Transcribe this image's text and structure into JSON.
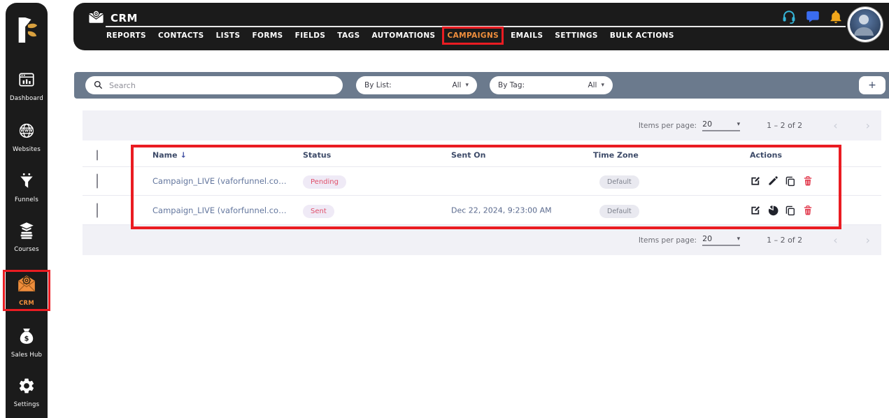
{
  "app": {
    "window_title": "CRM"
  },
  "colors": {
    "sidebar_bg": "#1b1b1b",
    "accent_orange": "#ef8e3c",
    "annotation_red": "#ea1c22",
    "filter_bar_bg": "#6b7a8d",
    "strip_bg": "#f1f1f6",
    "header_text": "#3c4a68",
    "row_link_text": "#64779e",
    "badge_red_text": "#e0506a",
    "badge_red_bg": "#efeaf6",
    "badge_gray_text": "#7d818c",
    "badge_gray_bg": "#e9e9f0",
    "delete_red": "#e23b4e",
    "headset_cyan": "#35b6d9",
    "chat_blue": "#3a6df0",
    "bell_amber": "#f2a71b"
  },
  "sidebar": {
    "items": [
      {
        "label": "Dashboard",
        "icon": "dashboard-icon",
        "active": false
      },
      {
        "label": "Websites",
        "icon": "globe-icon",
        "active": false
      },
      {
        "label": "Funnels",
        "icon": "funnel-icon",
        "active": false
      },
      {
        "label": "Courses",
        "icon": "courses-icon",
        "active": false
      },
      {
        "label": "CRM",
        "icon": "crm-envelope-icon",
        "active": true,
        "annotated": true
      },
      {
        "label": "Sales Hub",
        "icon": "money-bag-icon",
        "active": false
      },
      {
        "label": "Settings",
        "icon": "gear-icon",
        "active": false
      }
    ]
  },
  "header": {
    "title": "CRM",
    "nav": [
      {
        "label": "REPORTS",
        "active": false
      },
      {
        "label": "CONTACTS",
        "active": false
      },
      {
        "label": "LISTS",
        "active": false
      },
      {
        "label": "FORMS",
        "active": false
      },
      {
        "label": "FIELDS",
        "active": false
      },
      {
        "label": "TAGS",
        "active": false
      },
      {
        "label": "AUTOMATIONS",
        "active": false
      },
      {
        "label": "CAMPAIGNS",
        "active": true,
        "annotated": true
      },
      {
        "label": "EMAILS",
        "active": false
      },
      {
        "label": "SETTINGS",
        "active": false
      },
      {
        "label": "BULK ACTIONS",
        "active": false
      }
    ],
    "icons": [
      "headset-icon",
      "chat-icon",
      "bell-icon",
      "avatar"
    ]
  },
  "filter_bar": {
    "search_placeholder": "Search",
    "by_list_label": "By List:",
    "by_list_value": "All",
    "by_tag_label": "By Tag:",
    "by_tag_value": "All",
    "add_label": "+"
  },
  "pagination": {
    "items_per_page_label": "Items per page:",
    "items_per_page_value": "20",
    "range": "1 – 2 of 2"
  },
  "table": {
    "columns": [
      "Name",
      "Status",
      "Sent On",
      "Time Zone",
      "Actions"
    ],
    "rows": [
      {
        "name": "Campaign_LIVE (vaforfunnel.co…",
        "status": "Pending",
        "sent_on": "",
        "time_zone": "Default",
        "actions": [
          "edit-note-icon",
          "pencil-icon",
          "copy-icon",
          "delete-icon"
        ]
      },
      {
        "name": "Campaign_LIVE (vaforfunnel.co…",
        "status": "Sent",
        "sent_on": "Dec 22, 2024, 9:23:00 AM",
        "time_zone": "Default",
        "actions": [
          "edit-note-icon",
          "pie-chart-icon",
          "copy-icon",
          "delete-icon"
        ]
      }
    ]
  },
  "glyphs": {
    "caret_down": "▾",
    "sort_down": "↓",
    "chevron_left": "‹",
    "chevron_right": "›"
  }
}
